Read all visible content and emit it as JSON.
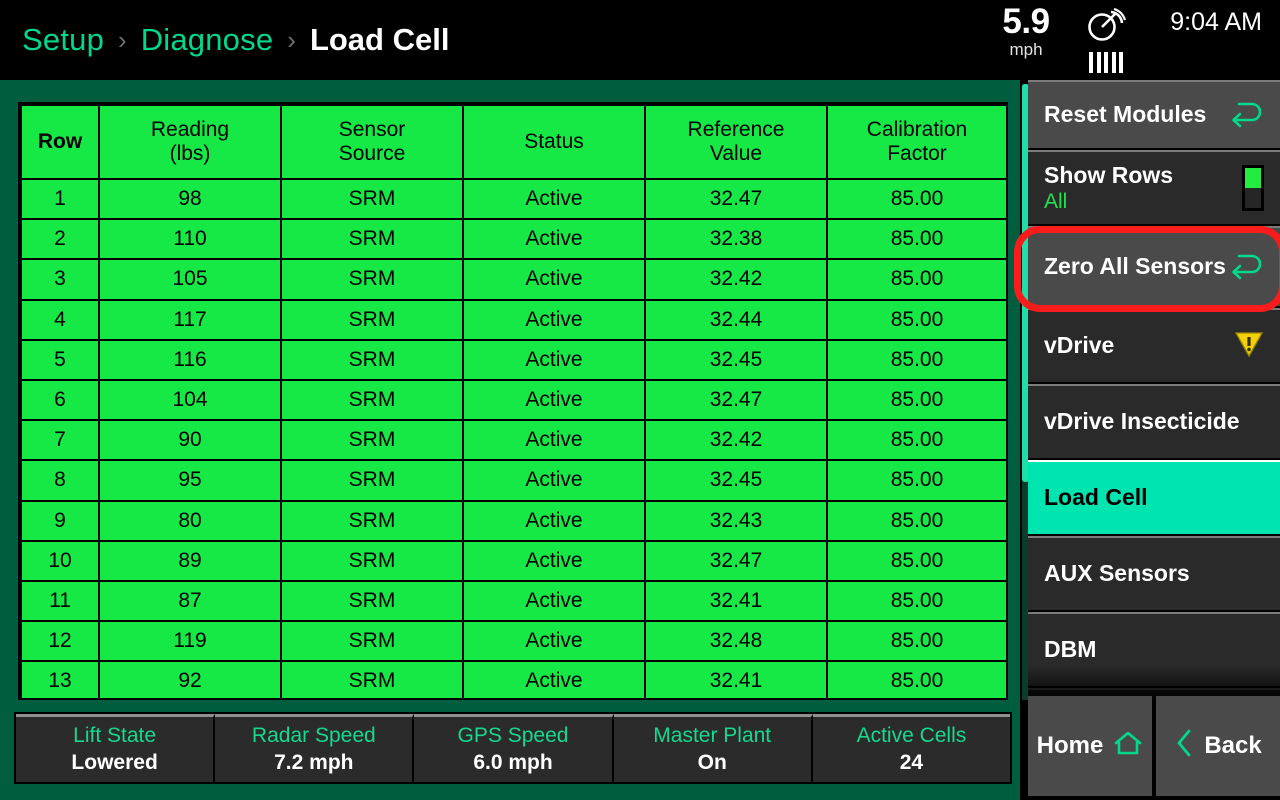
{
  "header": {
    "breadcrumb": [
      {
        "label": "Setup",
        "current": false
      },
      {
        "label": "Diagnose",
        "current": false
      },
      {
        "label": "Load Cell",
        "current": true
      }
    ],
    "separator": "›",
    "speed_value": "5.9",
    "speed_unit": "mph",
    "gps_icon": "satellite-dish-icon",
    "gps_bars": 5,
    "clock": "9:04 AM"
  },
  "table": {
    "columns": [
      {
        "label": "Row",
        "bold": true
      },
      {
        "label": "Reading\n(lbs)",
        "line1": "Reading",
        "line2": "(lbs)",
        "bold": false
      },
      {
        "label": "Sensor\nSource",
        "line1": "Sensor",
        "line2": "Source",
        "bold": false
      },
      {
        "label": "Status",
        "line1": "Status",
        "line2": "",
        "bold": false
      },
      {
        "label": "Reference\nValue",
        "line1": "Reference",
        "line2": "Value",
        "bold": false
      },
      {
        "label": "Calibration\nFactor",
        "line1": "Calibration",
        "line2": "Factor",
        "bold": false
      }
    ],
    "rows": [
      {
        "row": "1",
        "reading": "98",
        "source": "SRM",
        "status": "Active",
        "reference": "32.47",
        "calibration": "85.00"
      },
      {
        "row": "2",
        "reading": "110",
        "source": "SRM",
        "status": "Active",
        "reference": "32.38",
        "calibration": "85.00"
      },
      {
        "row": "3",
        "reading": "105",
        "source": "SRM",
        "status": "Active",
        "reference": "32.42",
        "calibration": "85.00"
      },
      {
        "row": "4",
        "reading": "117",
        "source": "SRM",
        "status": "Active",
        "reference": "32.44",
        "calibration": "85.00"
      },
      {
        "row": "5",
        "reading": "116",
        "source": "SRM",
        "status": "Active",
        "reference": "32.45",
        "calibration": "85.00"
      },
      {
        "row": "6",
        "reading": "104",
        "source": "SRM",
        "status": "Active",
        "reference": "32.47",
        "calibration": "85.00"
      },
      {
        "row": "7",
        "reading": "90",
        "source": "SRM",
        "status": "Active",
        "reference": "32.42",
        "calibration": "85.00"
      },
      {
        "row": "8",
        "reading": "95",
        "source": "SRM",
        "status": "Active",
        "reference": "32.45",
        "calibration": "85.00"
      },
      {
        "row": "9",
        "reading": "80",
        "source": "SRM",
        "status": "Active",
        "reference": "32.43",
        "calibration": "85.00"
      },
      {
        "row": "10",
        "reading": "89",
        "source": "SRM",
        "status": "Active",
        "reference": "32.47",
        "calibration": "85.00"
      },
      {
        "row": "11",
        "reading": "87",
        "source": "SRM",
        "status": "Active",
        "reference": "32.41",
        "calibration": "85.00"
      },
      {
        "row": "12",
        "reading": "119",
        "source": "SRM",
        "status": "Active",
        "reference": "32.48",
        "calibration": "85.00"
      },
      {
        "row": "13",
        "reading": "92",
        "source": "SRM",
        "status": "Active",
        "reference": "32.41",
        "calibration": "85.00"
      }
    ]
  },
  "statusbar": [
    {
      "label": "Lift State",
      "value": "Lowered"
    },
    {
      "label": "Radar Speed",
      "value": "7.2 mph"
    },
    {
      "label": "GPS Speed",
      "value": "6.0 mph"
    },
    {
      "label": "Master Plant",
      "value": "On"
    },
    {
      "label": "Active Cells",
      "value": "24"
    }
  ],
  "sidebar": {
    "items": [
      {
        "title": "Reset Modules",
        "sub": "",
        "icon": "reset-arrow-icon",
        "kind": "action",
        "selected": false
      },
      {
        "title": "Show Rows",
        "sub": "All",
        "icon": "toggle-switch",
        "kind": "toggle",
        "selected": false
      },
      {
        "title": "Zero All Sensors",
        "sub": "",
        "icon": "reset-arrow-icon",
        "kind": "action",
        "selected": false
      },
      {
        "title": "vDrive",
        "sub": "",
        "icon": "warning-icon",
        "kind": "nav",
        "selected": false
      },
      {
        "title": "vDrive Insecticide",
        "sub": "",
        "icon": "",
        "kind": "nav",
        "selected": false
      },
      {
        "title": "Load Cell",
        "sub": "",
        "icon": "",
        "kind": "nav",
        "selected": true
      },
      {
        "title": "AUX Sensors",
        "sub": "",
        "icon": "",
        "kind": "nav",
        "selected": false
      },
      {
        "title": "DBM",
        "sub": "",
        "icon": "",
        "kind": "nav",
        "selected": false
      },
      {
        "title": "",
        "sub": "",
        "icon": "",
        "kind": "nav",
        "selected": false
      }
    ],
    "nav": {
      "home_label": "Home",
      "home_icon": "home-icon",
      "back_label": "Back",
      "back_icon": "chevron-left-icon"
    }
  },
  "highlight": {
    "target": "Zero All Sensors",
    "color": "#f91c1c"
  },
  "colors": {
    "accent_teal": "#00d98b",
    "table_green": "#16e845",
    "page_green": "#005d3e",
    "selected_teal": "#00e5b0",
    "warning_yellow": "#f2d108",
    "highlight_red": "#f91c1c"
  }
}
